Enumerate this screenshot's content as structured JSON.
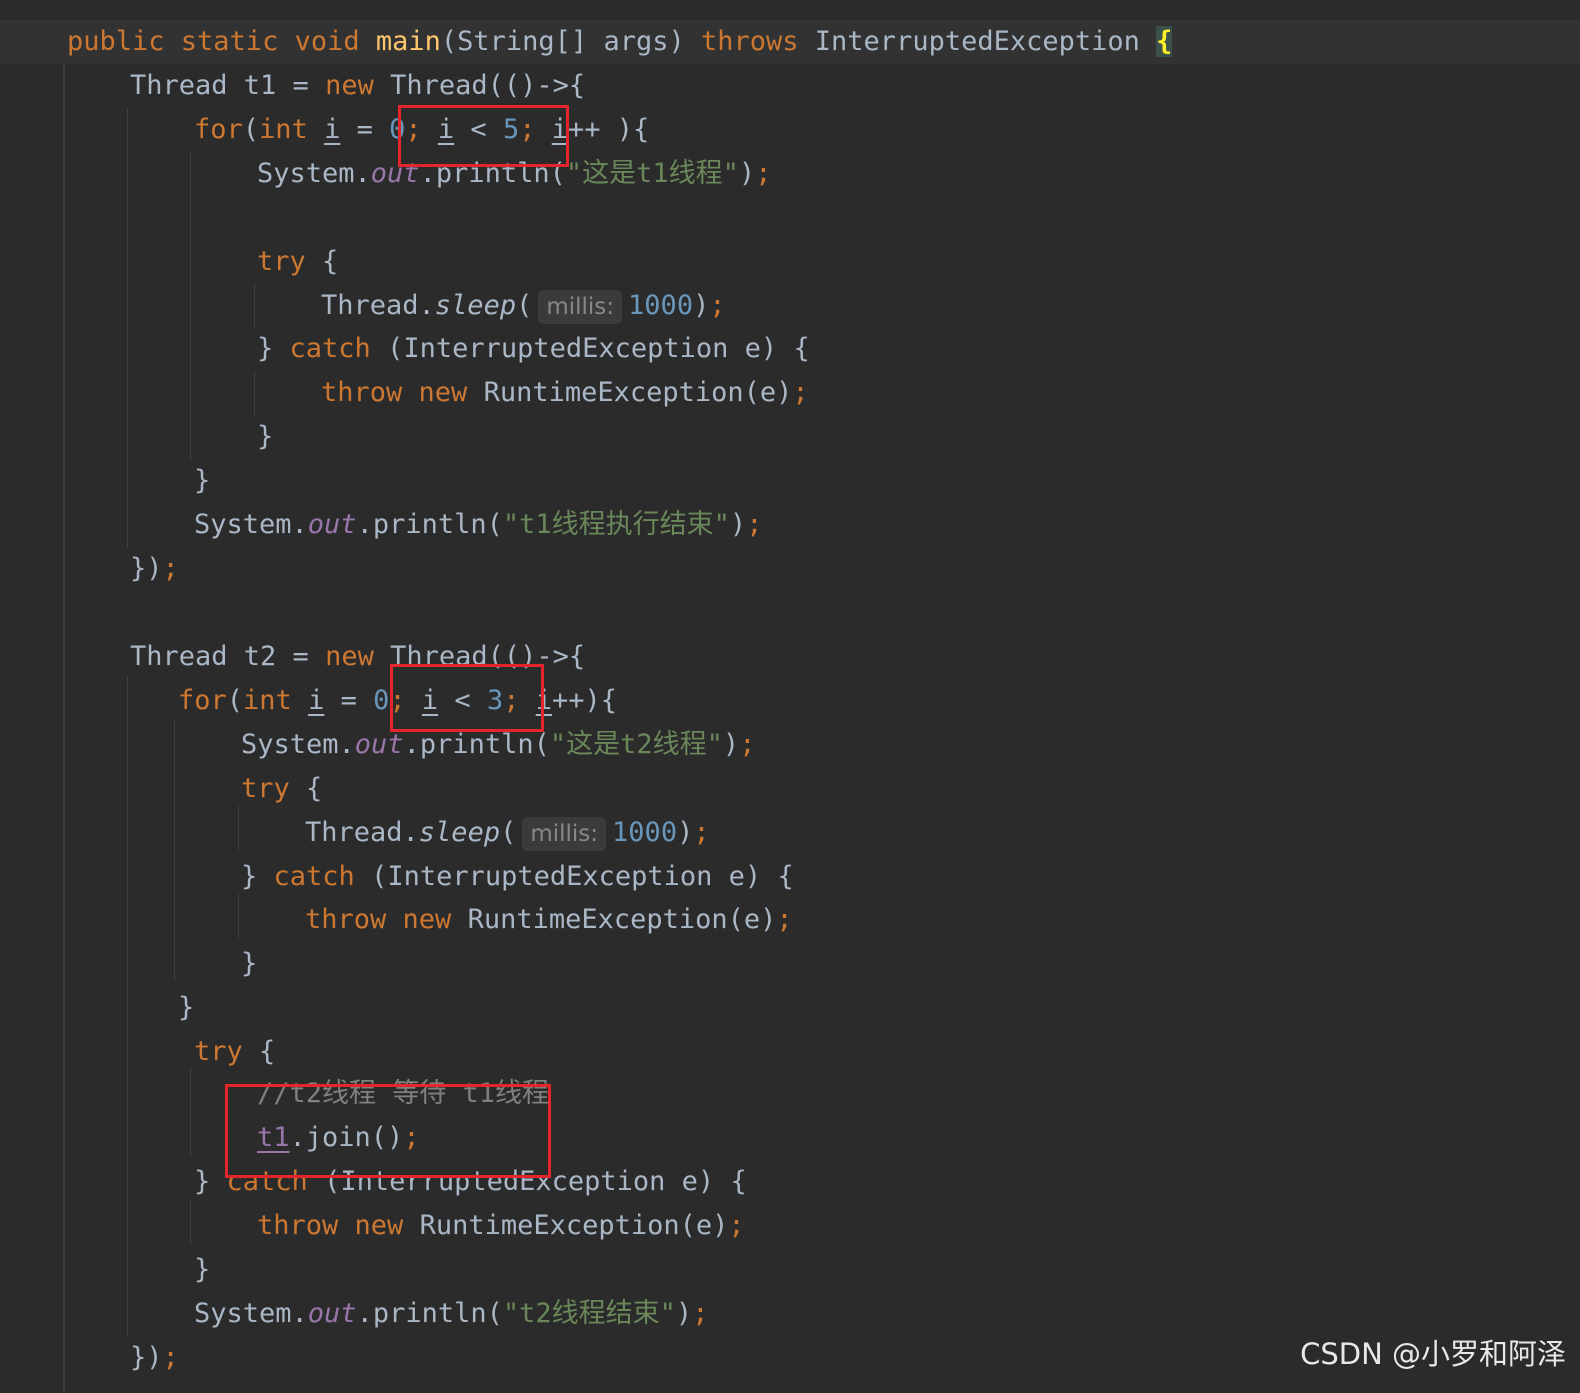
{
  "editor": {
    "lines": [
      {
        "tokens": [
          {
            "t": "public static void ",
            "c": "kw"
          },
          {
            "t": "main",
            "c": "fn"
          },
          {
            "t": "(String[] args) "
          },
          {
            "t": "throws ",
            "c": "kw"
          },
          {
            "t": "InterruptedException "
          },
          {
            "t": "{",
            "c": "brace-hl"
          }
        ]
      },
      {
        "tokens": [
          {
            "t": "Thread t1 = "
          },
          {
            "t": "new ",
            "c": "kw"
          },
          {
            "t": "Thread(()->{"
          }
        ]
      },
      {
        "tokens": [
          {
            "t": "for",
            "c": "kw"
          },
          {
            "t": "("
          },
          {
            "t": "int ",
            "c": "kw"
          },
          {
            "t": "i",
            "c": "u"
          },
          {
            "t": " = "
          },
          {
            "t": "0",
            "c": "num"
          },
          {
            "t": "; ",
            "c": "kw"
          },
          {
            "t": "i",
            "c": "u"
          },
          {
            "t": " < "
          },
          {
            "t": "5",
            "c": "num"
          },
          {
            "t": "; ",
            "c": "kw"
          },
          {
            "t": "i",
            "c": "u"
          },
          {
            "t": "++ ){"
          }
        ]
      },
      {
        "tokens": [
          {
            "t": "System."
          },
          {
            "t": "out",
            "c": "field"
          },
          {
            "t": ".println("
          },
          {
            "t": "\"这是t1线程\"",
            "c": "str"
          },
          {
            "t": ")"
          },
          {
            "t": ";",
            "c": "kw"
          }
        ]
      },
      {
        "tokens": []
      },
      {
        "tokens": [
          {
            "t": "try ",
            "c": "kw"
          },
          {
            "t": "{"
          }
        ]
      },
      {
        "tokens": [
          {
            "t": "Thread."
          },
          {
            "t": "sleep",
            "c": "static"
          },
          {
            "t": "("
          },
          {
            "t": "millis:",
            "c": "hint"
          },
          {
            "t": "1000",
            "c": "num"
          },
          {
            "t": ")"
          },
          {
            "t": ";",
            "c": "kw"
          }
        ]
      },
      {
        "tokens": [
          {
            "t": "} "
          },
          {
            "t": "catch ",
            "c": "kw"
          },
          {
            "t": "(InterruptedException e) {"
          }
        ]
      },
      {
        "tokens": [
          {
            "t": "throw new ",
            "c": "kw"
          },
          {
            "t": "RuntimeException(e)"
          },
          {
            "t": ";",
            "c": "kw"
          }
        ]
      },
      {
        "tokens": [
          {
            "t": "}"
          }
        ]
      },
      {
        "tokens": [
          {
            "t": "}"
          }
        ]
      },
      {
        "tokens": [
          {
            "t": "System."
          },
          {
            "t": "out",
            "c": "field"
          },
          {
            "t": ".println("
          },
          {
            "t": "\"t1线程执行结束\"",
            "c": "str"
          },
          {
            "t": ")"
          },
          {
            "t": ";",
            "c": "kw"
          }
        ]
      },
      {
        "tokens": [
          {
            "t": "})"
          },
          {
            "t": ";",
            "c": "kw"
          }
        ]
      },
      {
        "tokens": []
      },
      {
        "tokens": [
          {
            "t": "Thread t2 = "
          },
          {
            "t": "new ",
            "c": "kw"
          },
          {
            "t": "Thread(()->{"
          }
        ]
      },
      {
        "tokens": [
          {
            "t": "for",
            "c": "kw"
          },
          {
            "t": "("
          },
          {
            "t": "int ",
            "c": "kw"
          },
          {
            "t": "i",
            "c": "u"
          },
          {
            "t": " = "
          },
          {
            "t": "0",
            "c": "num"
          },
          {
            "t": "; ",
            "c": "kw"
          },
          {
            "t": "i",
            "c": "u"
          },
          {
            "t": " < "
          },
          {
            "t": "3",
            "c": "num"
          },
          {
            "t": "; ",
            "c": "kw"
          },
          {
            "t": "i",
            "c": "u"
          },
          {
            "t": "++){"
          }
        ]
      },
      {
        "tokens": [
          {
            "t": "System."
          },
          {
            "t": "out",
            "c": "field"
          },
          {
            "t": ".println("
          },
          {
            "t": "\"这是t2线程\"",
            "c": "str"
          },
          {
            "t": ")"
          },
          {
            "t": ";",
            "c": "kw"
          }
        ]
      },
      {
        "tokens": [
          {
            "t": "try ",
            "c": "kw"
          },
          {
            "t": "{"
          }
        ]
      },
      {
        "tokens": [
          {
            "t": "Thread."
          },
          {
            "t": "sleep",
            "c": "static"
          },
          {
            "t": "("
          },
          {
            "t": "millis:",
            "c": "hint"
          },
          {
            "t": "1000",
            "c": "num"
          },
          {
            "t": ")"
          },
          {
            "t": ";",
            "c": "kw"
          }
        ]
      },
      {
        "tokens": [
          {
            "t": "} "
          },
          {
            "t": "catch ",
            "c": "kw"
          },
          {
            "t": "(InterruptedException e) {"
          }
        ]
      },
      {
        "tokens": [
          {
            "t": "throw new ",
            "c": "kw"
          },
          {
            "t": "RuntimeException(e)"
          },
          {
            "t": ";",
            "c": "kw"
          }
        ]
      },
      {
        "tokens": [
          {
            "t": "}"
          }
        ]
      },
      {
        "tokens": [
          {
            "t": "}"
          }
        ]
      },
      {
        "tokens": [
          {
            "t": "try ",
            "c": "kw"
          },
          {
            "t": "{"
          }
        ]
      },
      {
        "tokens": [
          {
            "t": "//t2线程 等待 t1线程",
            "c": "cmt"
          }
        ]
      },
      {
        "tokens": [
          {
            "t": "t1",
            "c": "field-u"
          },
          {
            "t": ".join()"
          },
          {
            "t": ";",
            "c": "kw"
          }
        ]
      },
      {
        "tokens": [
          {
            "t": "} "
          },
          {
            "t": "catch ",
            "c": "kw"
          },
          {
            "t": "(InterruptedException e) {"
          }
        ]
      },
      {
        "tokens": [
          {
            "t": "throw new ",
            "c": "kw"
          },
          {
            "t": "RuntimeException(e)"
          },
          {
            "t": ";",
            "c": "kw"
          }
        ]
      },
      {
        "tokens": [
          {
            "t": "}"
          }
        ]
      },
      {
        "tokens": [
          {
            "t": "System."
          },
          {
            "t": "out",
            "c": "field"
          },
          {
            "t": ".println("
          },
          {
            "t": "\"t2线程结束\"",
            "c": "str"
          },
          {
            "t": ")"
          },
          {
            "t": ";",
            "c": "kw"
          }
        ]
      },
      {
        "tokens": [
          {
            "t": "})"
          },
          {
            "t": ";",
            "c": "kw"
          }
        ]
      }
    ]
  },
  "watermark": "CSDN @小罗和阿泽",
  "colors": {
    "keyword": "#cc7832",
    "string": "#6a8759",
    "number": "#6897bb",
    "field": "#9876aa",
    "highlight_box": "#e3252c"
  }
}
